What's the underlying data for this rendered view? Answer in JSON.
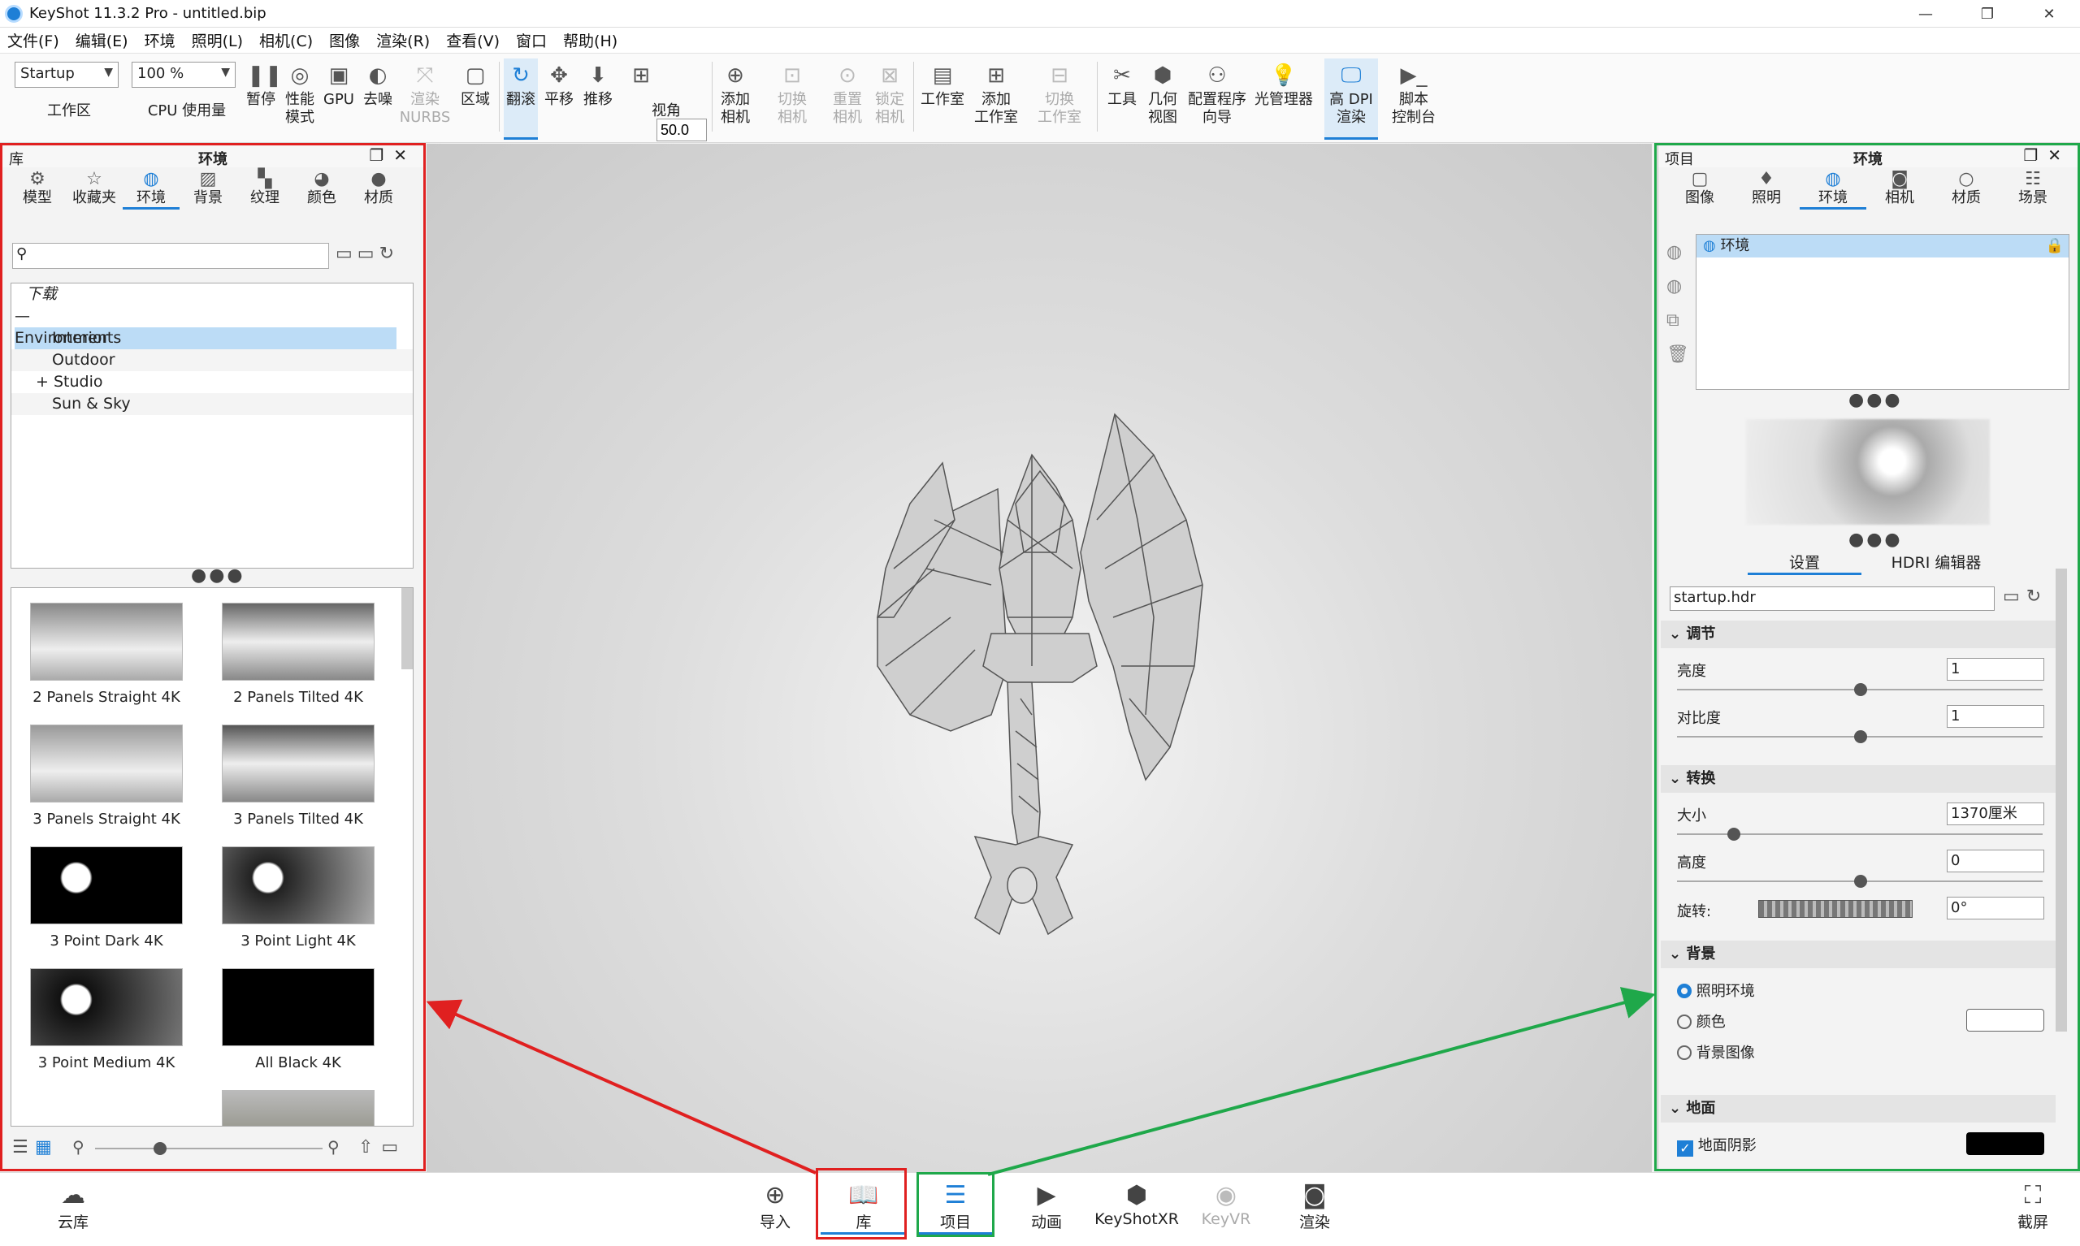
{
  "window": {
    "title": "KeyShot 11.3.2 Pro  - untitled.bip",
    "controls": [
      "—",
      "❐",
      "✕"
    ]
  },
  "menu": [
    "文件(F)",
    "编辑(E)",
    "环境",
    "照明(L)",
    "相机(C)",
    "图像",
    "渲染(R)",
    "查看(V)",
    "窗口",
    "帮助(H)"
  ],
  "toolbar": {
    "workspace_value": "Startup",
    "workspace_label": "工作区",
    "cpu_value": "100 %",
    "cpu_label": "CPU 使用量",
    "pause": "暂停",
    "perf1": "性能",
    "perf2": "模式",
    "gpu": "GPU",
    "denoise": "去噪",
    "nurbs1": "渲染",
    "nurbs2": "NURBS",
    "region": "区域",
    "tumble": "翻滚",
    "pan": "平移",
    "dolly": "推移",
    "fov_value": "50.0",
    "fov_label": "视角",
    "addcam1": "添加",
    "addcam2": "相机",
    "switchcam1": "切换",
    "switchcam2": "相机",
    "resetcam1": "重置",
    "resetcam2": "相机",
    "lockcam1": "锁定",
    "lockcam2": "相机",
    "studio": "工作室",
    "addstudio1": "添加",
    "addstudio2": "工作室",
    "switchstudio1": "切换",
    "switchstudio2": "工作室",
    "tools": "工具",
    "geo1": "几何",
    "geo2": "视图",
    "wizard1": "配置程序",
    "wizard2": "向导",
    "lightmgr": "光管理器",
    "hidpi1": "高 DPI",
    "hidpi2": "渲染",
    "script1": "脚本",
    "script2": "控制台"
  },
  "library": {
    "title_left": "库",
    "title_center": "环境",
    "tabs": [
      "模型",
      "收藏夹",
      "环境",
      "背景",
      "纹理",
      "颜色",
      "材质"
    ],
    "tree": [
      "下载",
      "Environments",
      "Interior",
      "Outdoor",
      "Studio",
      "Sun & Sky"
    ],
    "thumbs": [
      "2 Panels Straight 4K",
      "2 Panels Tilted 4K",
      "3 Panels Straight 4K",
      "3 Panels Tilted 4K",
      "3 Point Dark 4K",
      "3 Point Light 4K",
      "3 Point Medium 4K",
      "All Black 4K"
    ]
  },
  "project": {
    "title_left": "项目",
    "title_center": "环境",
    "tabs": [
      "图像",
      "照明",
      "环境",
      "相机",
      "材质",
      "场景"
    ],
    "env_item": "环境",
    "subtabs": [
      "设置",
      "HDRI 编辑器"
    ],
    "hdr_file": "startup.hdr",
    "sections": {
      "adjust": "调节",
      "transform": "转换",
      "background": "背景",
      "ground": "地面"
    },
    "brightness_label": "亮度",
    "brightness_value": "1",
    "contrast_label": "对比度",
    "contrast_value": "1",
    "size_label": "大小",
    "size_value": "1370厘米",
    "height_label": "高度",
    "height_value": "0",
    "rotation_label": "旋转:",
    "rotation_value": "0°",
    "bg_options": [
      "照明环境",
      "颜色",
      "背景图像"
    ],
    "ground_shadow": "地面阴影"
  },
  "bottom": [
    "云库",
    "导入",
    "库",
    "项目",
    "动画",
    "KeyShotXR",
    "KeyVR",
    "渲染",
    "截屏"
  ],
  "colors": {
    "accent": "#1e7fd6",
    "red_highlight": "#e02020",
    "green_highlight": "#1fa84a"
  }
}
